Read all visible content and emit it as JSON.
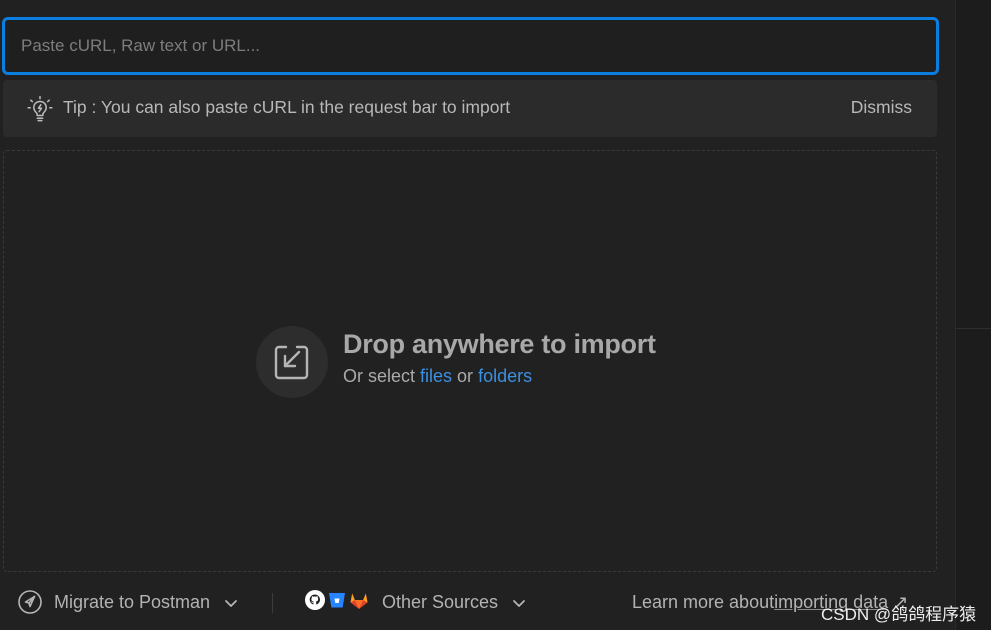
{
  "input": {
    "placeholder": "Paste cURL, Raw text or URL..."
  },
  "tip": {
    "text": "Tip : You can also paste cURL in the request bar to import",
    "dismiss_label": "Dismiss",
    "icon": "lightbulb-icon"
  },
  "drop": {
    "icon": "import-icon",
    "title": "Drop anywhere to import",
    "sub_prefix": "Or select ",
    "files_link": "files",
    "sub_middle": " or ",
    "folders_link": "folders"
  },
  "footer": {
    "migrate_label": "Migrate to Postman",
    "migrate_icon": "postman-logo-icon",
    "other_sources_label": "Other Sources",
    "other_source_icons": [
      "github-icon",
      "bitbucket-icon",
      "gitlab-icon"
    ],
    "learn_prefix": "Learn more about ",
    "learn_link": "importing data",
    "learn_arrow": "↗"
  },
  "watermark": "CSDN @鸽鸽程序猿",
  "colors": {
    "accent": "#0b7fe0",
    "link": "#3d8fe0",
    "background": "#212121",
    "tip_background": "#2b2b2b"
  }
}
